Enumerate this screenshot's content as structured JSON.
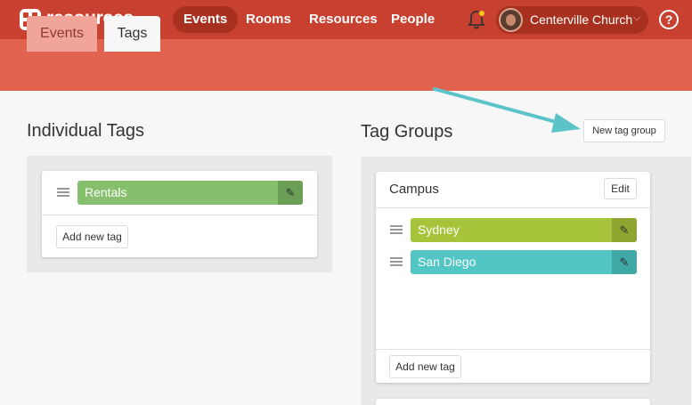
{
  "header": {
    "brand": "resources",
    "nav": [
      {
        "label": "Events",
        "active": true
      },
      {
        "label": "Rooms",
        "active": false
      },
      {
        "label": "Resources",
        "active": false
      },
      {
        "label": "People",
        "active": false
      }
    ],
    "org_name": "Centerville Church",
    "help_glyph": "?",
    "icons": [
      "logo-icon",
      "chevron-down-icon",
      "bell-icon",
      "avatar",
      "help-icon"
    ]
  },
  "tabs": [
    {
      "label": "Events",
      "active": false
    },
    {
      "label": "Tags",
      "active": true
    }
  ],
  "individual_tags": {
    "heading": "Individual Tags",
    "tags": [
      {
        "label": "Rentals",
        "color": "#86c06c",
        "edit_color": "#6a9f55"
      }
    ],
    "add_button": "Add new tag"
  },
  "tag_groups": {
    "heading": "Tag Groups",
    "new_group_button": "New tag group",
    "groups": [
      {
        "title": "Campus",
        "edit_button": "Edit",
        "tags": [
          {
            "label": "Sydney",
            "color": "#a6c43a",
            "edit_color": "#8ba52f"
          },
          {
            "label": "San Diego",
            "color": "#52c6c5",
            "edit_color": "#40a8a7"
          }
        ],
        "add_button": "Add new tag"
      }
    ]
  },
  "colors": {
    "brand": "#c8402f",
    "subbar": "#e0624f",
    "annotation_arrow": "#5cc4c9"
  }
}
